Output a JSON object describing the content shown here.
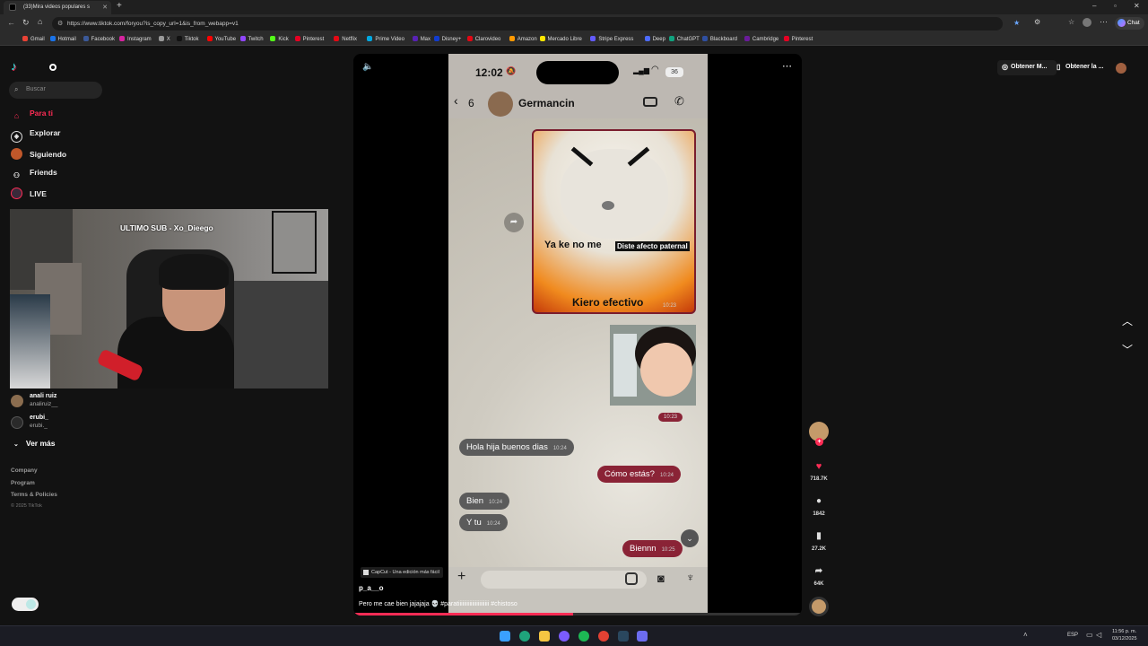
{
  "browser": {
    "tab_title": "(33)Mira videos populares s",
    "url": "https://www.tiktok.com/foryou?is_copy_url=1&is_from_webapp=v1",
    "chat_label": "Chat",
    "bookmarks": [
      "Gmail",
      "Hotmail",
      "Facebook",
      "Instagram",
      "X",
      "Tiktok",
      "YouTube",
      "Twitch",
      "Kick",
      "Pinterest",
      "Netflix",
      "Prime Video",
      "Max",
      "Disney+",
      "Clarovideo",
      "Amazon",
      "Mercado Libre",
      "Stripe Express",
      "Deep",
      "ChatGPT",
      "Blackboard",
      "Cambridge",
      "Pinterest"
    ]
  },
  "sidebar": {
    "search_placeholder": "Buscar",
    "nav": [
      {
        "label": "Para ti",
        "icon": "home-icon"
      },
      {
        "label": "Explorar",
        "icon": "compass-icon"
      },
      {
        "label": "Siguiendo",
        "icon": "following-icon"
      },
      {
        "label": "Friends",
        "icon": "friends-icon"
      },
      {
        "label": "LIVE",
        "icon": "live-icon"
      }
    ],
    "stream_overlay_text": "ULTIMO SUB - Xo_Dieego",
    "following": [
      {
        "name": "anali ruiz",
        "handle": "analiruiz__"
      },
      {
        "name": "erubi_",
        "handle": "erubi._"
      }
    ],
    "see_more": "Ver más",
    "footer": [
      "Company",
      "Program",
      "Terms & Policies",
      "© 2025 TikTok"
    ]
  },
  "top_right": {
    "btn1": "Obtener M...",
    "btn2": "Obtener la ..."
  },
  "phone": {
    "time": "12:02",
    "battery": "36",
    "back_count": "6",
    "contact": "Germancin",
    "meme_text_1": "Ya ke no me",
    "meme_label": "Diste afecto paternal",
    "meme_text_2": "Kiero efectivo",
    "meme_time": "10:23",
    "photo_time": "10:23",
    "messages": [
      {
        "text": "Hola hija buenos dias",
        "time": "10:24",
        "dir": "in"
      },
      {
        "text": "Cómo estás?",
        "time": "10:24",
        "dir": "out"
      },
      {
        "text": "Bien",
        "time": "10:24",
        "dir": "in"
      },
      {
        "text": "Y tu",
        "time": "10:24",
        "dir": "in"
      },
      {
        "text": "Biennn",
        "time": "10:25",
        "dir": "out"
      }
    ]
  },
  "video": {
    "capcut": "CapCut - Una edición más fácil",
    "author": "p_a__o",
    "caption": "Pero me cae bien jajajaja 💀 #paratiiiiiiiiiiiiiiiiiiiiii #chistoso",
    "progress": 0.49
  },
  "actions": {
    "likes": "718.7K",
    "comments": "1842",
    "saves": "27.2K",
    "shares": "64K"
  },
  "taskbar": {
    "lang": "ESP",
    "time": "11:56 p. m.",
    "date": "03/12/2025"
  },
  "colors": {
    "accent": "#fe2c55",
    "bg": "#121212"
  }
}
